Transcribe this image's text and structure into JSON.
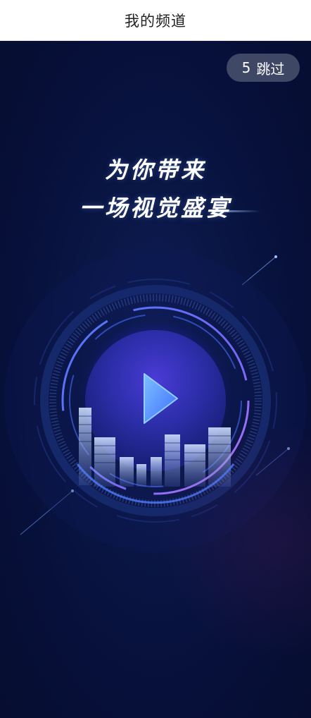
{
  "nav": {
    "title": "我的频道"
  },
  "skip": {
    "count": "5",
    "label": "跳过"
  },
  "headline": {
    "line1": "为你带来",
    "line2": "一场视觉盛宴"
  },
  "colors": {
    "nav_background": "#ffffff",
    "splash_background": "#07103a",
    "ring_blue": "#4f7dff",
    "ring_purple": "#b06bff",
    "play_icon": "#5fa8ff"
  },
  "icons": {
    "play": "play-icon",
    "emblem": "video-emblem-icon",
    "city": "city-skyline-icon"
  }
}
